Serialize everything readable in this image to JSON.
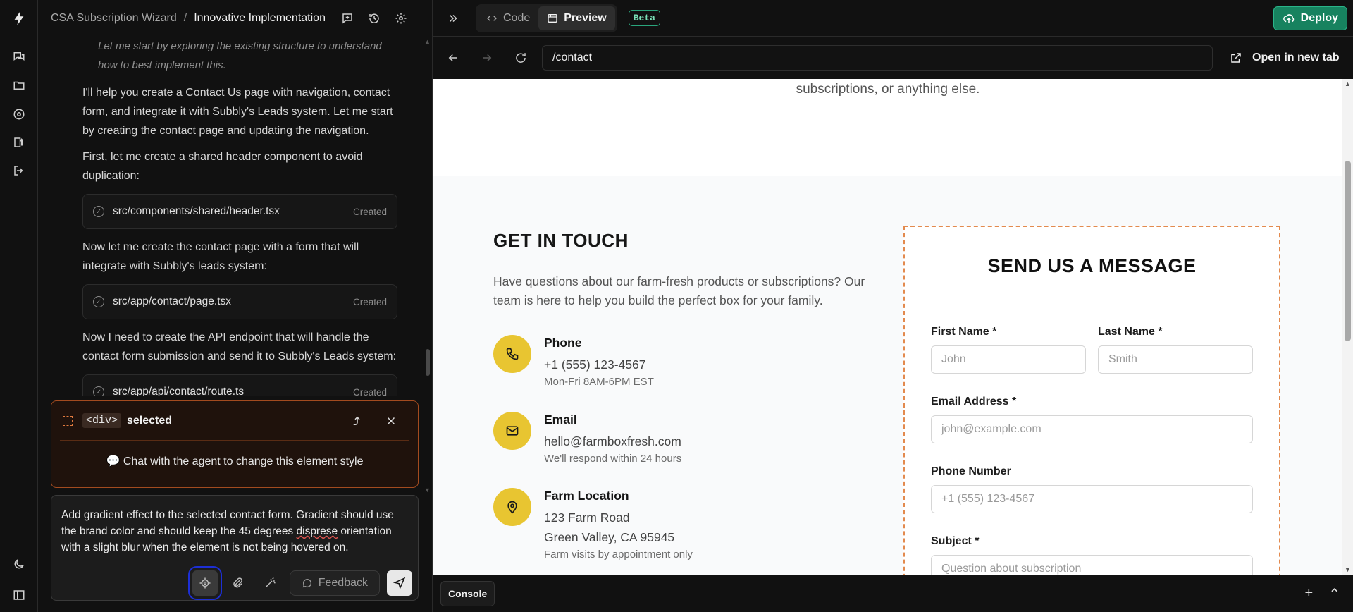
{
  "chat": {
    "project": "CSA Subscription Wizard",
    "separator": "/",
    "current": "Innovative Implementation",
    "messages": {
      "italic_intro": "Let me start by exploring the existing structure to understand how to best implement this.",
      "m1": "I'll help you create a Contact Us page with navigation, contact form, and integrate it with Subbly's Leads system. Let me start by creating the contact page and updating the navigation.",
      "m2": "First, let me create a shared header component to avoid duplication:",
      "f1": {
        "path": "src/components/shared/header.tsx",
        "status": "Created"
      },
      "m3": "Now let me create the contact page with a form that will integrate with Subbly's leads system:",
      "f2": {
        "path": "src/app/contact/page.tsx",
        "status": "Created"
      },
      "m4": "Now I need to create the API endpoint that will handle the contact form submission and send it to Subbly's Leads system:",
      "f3": {
        "path": "src/app/api/contact/route.ts",
        "status": "Created"
      }
    },
    "selection": {
      "tag": "<div>",
      "label": "selected",
      "hint": "💬 Chat with the agent to change this element style"
    },
    "input": {
      "before": "Add gradient effect to the selected contact form. Gradient should use the brand color and should keep the 45 degrees ",
      "misspelled": "disprese",
      "after": " orientation with a slight blur when the element is not being hovered on."
    },
    "feedback_label": "Feedback"
  },
  "topbar": {
    "code_tab": "Code",
    "preview_tab": "Preview",
    "beta": "Beta",
    "deploy": "Deploy"
  },
  "urlbar": {
    "url": "/contact",
    "open_new_tab": "Open in new tab"
  },
  "preview": {
    "intro_tail": "subscriptions, or anything else.",
    "git_title": "GET IN TOUCH",
    "git_desc": "Have questions about our farm-fresh products or subscriptions? Our team is here to help you build the perfect box for your family.",
    "phone": {
      "title": "Phone",
      "value": "+1 (555) 123-4567",
      "sub": "Mon-Fri 8AM-6PM EST"
    },
    "email": {
      "title": "Email",
      "value": "hello@farmboxfresh.com",
      "sub": "We'll respond within 24 hours"
    },
    "location": {
      "title": "Farm Location",
      "line1": "123 Farm Road",
      "line2": "Green Valley, CA 95945",
      "sub": "Farm visits by appointment only"
    },
    "form": {
      "title": "SEND US A MESSAGE",
      "first_label": "First Name *",
      "first_ph": "John",
      "last_label": "Last Name *",
      "last_ph": "Smith",
      "email_label": "Email Address *",
      "email_ph": "john@example.com",
      "phone_label": "Phone Number",
      "phone_ph": "+1 (555) 123-4567",
      "subject_label": "Subject *",
      "subject_ph": "Question about subscription"
    }
  },
  "console": {
    "label": "Console"
  },
  "colors": {
    "accent": "#e8c531",
    "deploy": "#17825f",
    "selection": "#e38a4e"
  }
}
